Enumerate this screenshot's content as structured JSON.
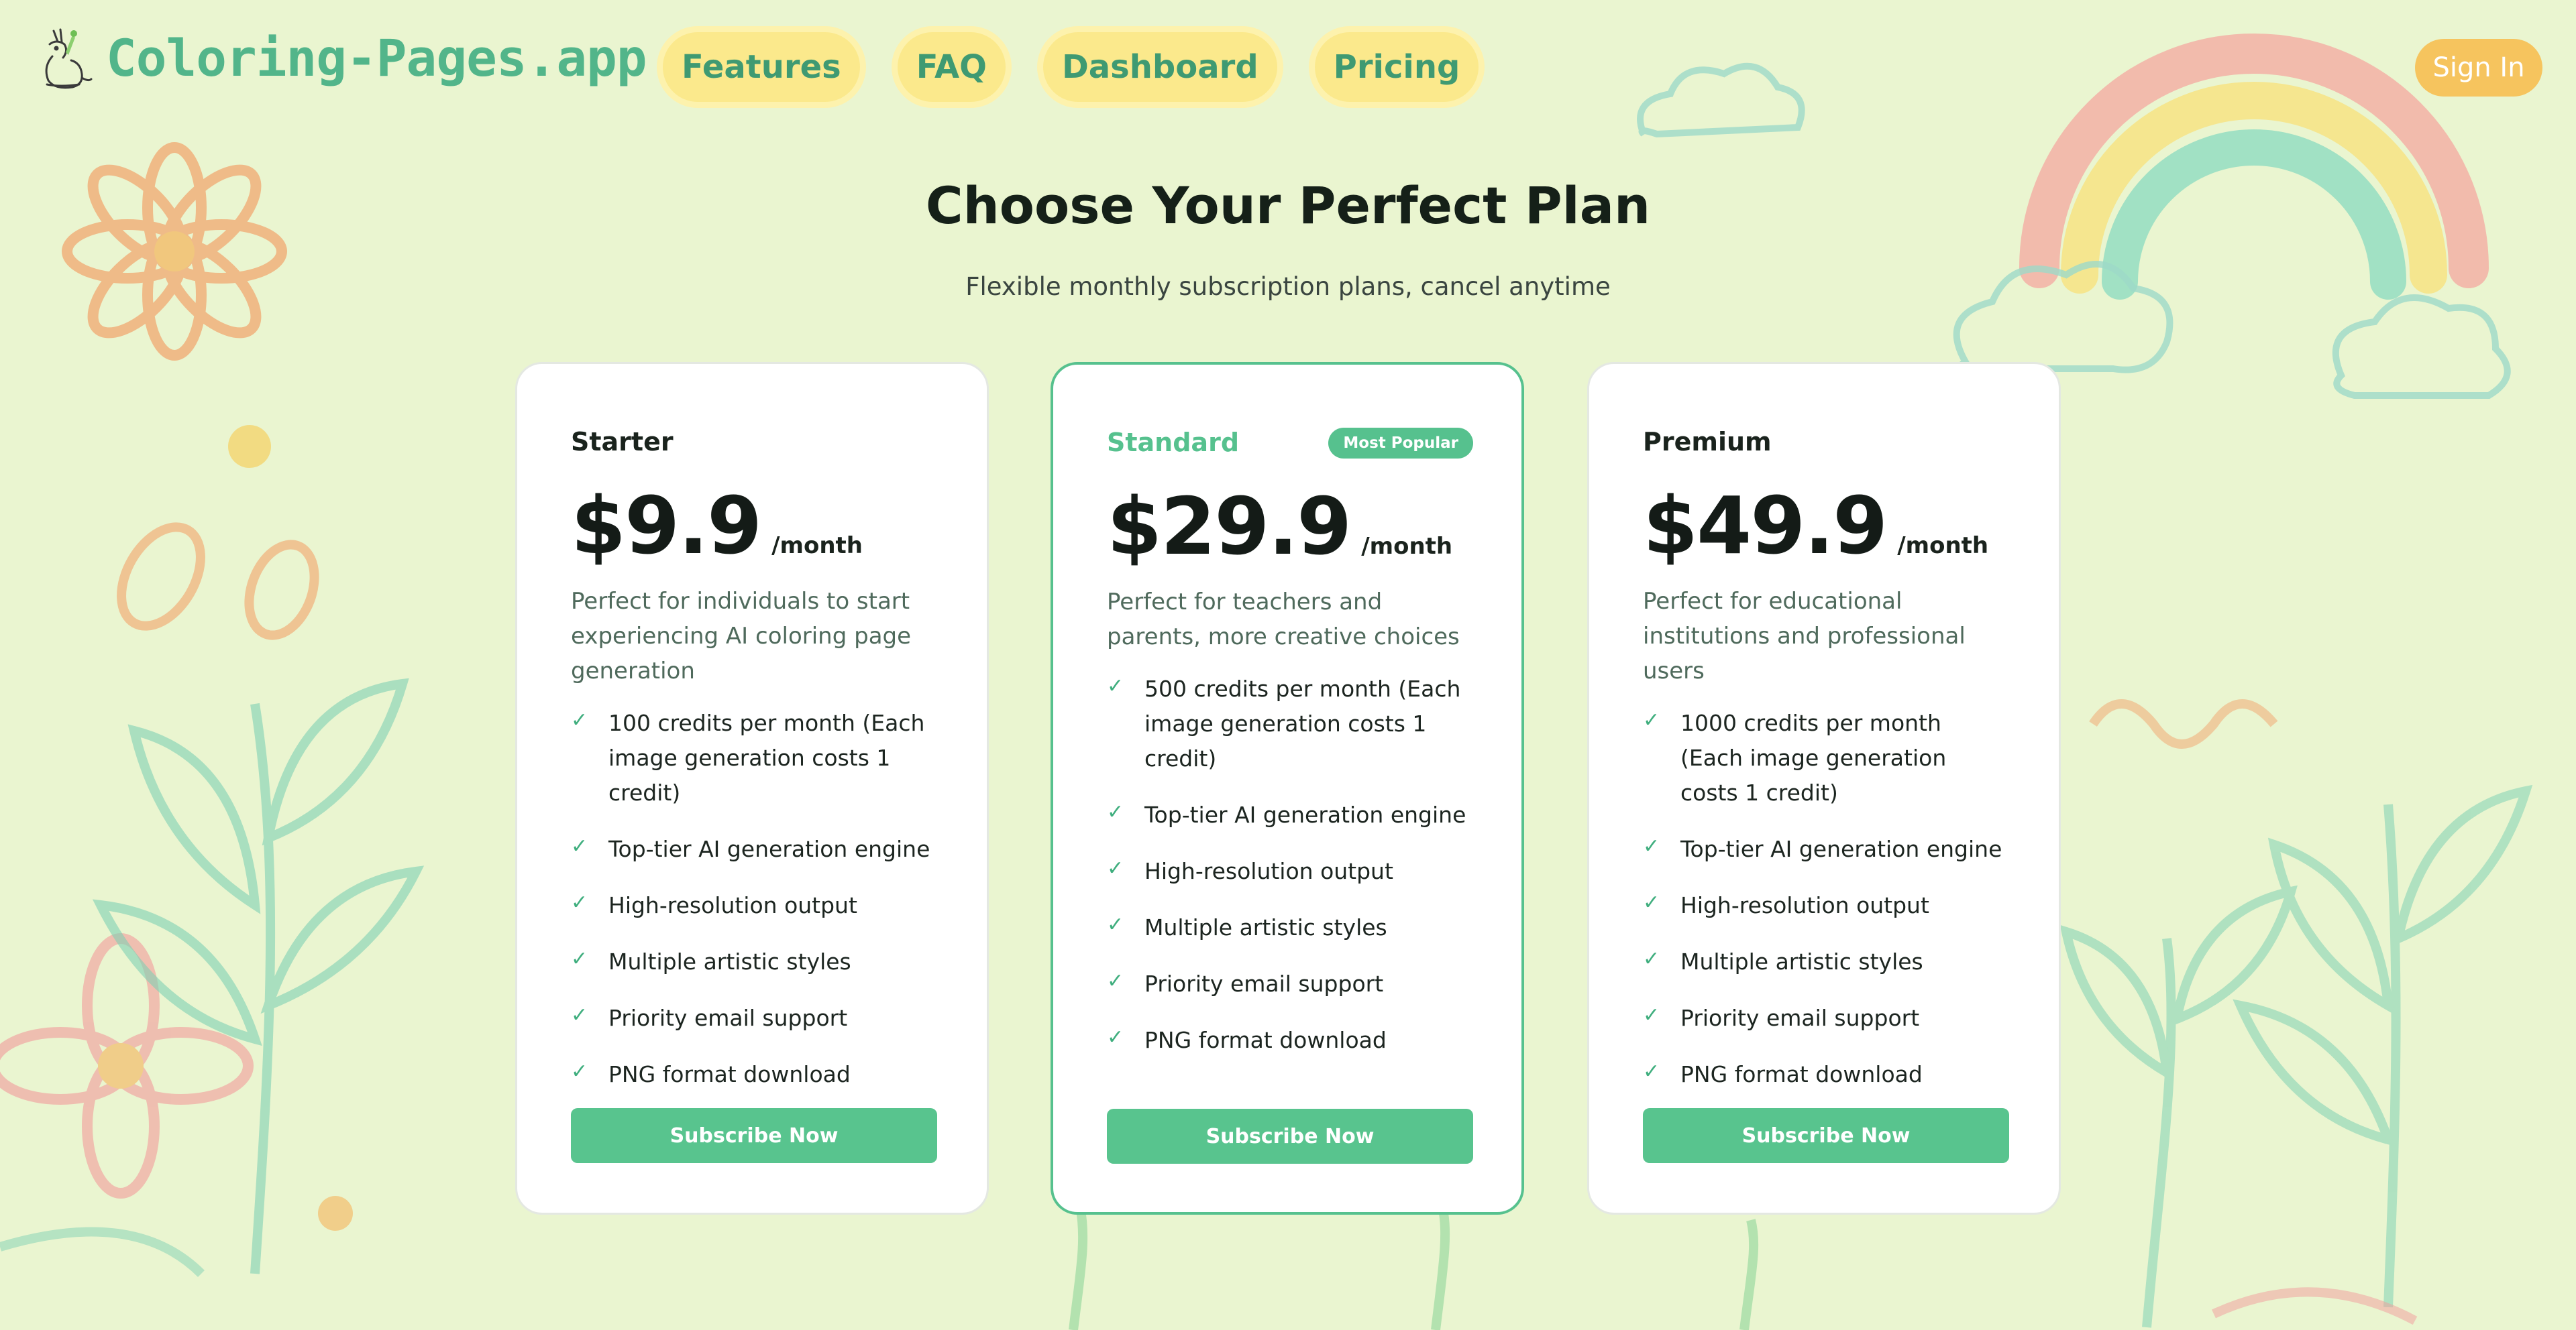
{
  "brand": {
    "name": "Coloring-Pages.app",
    "logo_icon": "kangaroo-logo-icon"
  },
  "nav": {
    "items": [
      {
        "label": "Features"
      },
      {
        "label": "FAQ"
      },
      {
        "label": "Dashboard"
      },
      {
        "label": "Pricing"
      }
    ],
    "signin_label": "Sign In"
  },
  "pricing": {
    "title": "Choose Your Perfect Plan",
    "subtitle": "Flexible monthly subscription plans, cancel anytime",
    "plans": [
      {
        "name": "Starter",
        "price": "$9.9",
        "period": "/month",
        "description": "Perfect for individuals to start experiencing AI coloring page generation",
        "features": [
          "100 credits per month (Each image generation costs 1 credit)",
          "Top-tier AI generation engine",
          "High-resolution output",
          "Multiple artistic styles",
          "Priority email support",
          "PNG format download"
        ],
        "cta": "Subscribe Now"
      },
      {
        "name": "Standard",
        "badge": "Most Popular",
        "price": "$29.9",
        "period": "/month",
        "description": "Perfect for teachers and parents, more creative choices",
        "features": [
          "500 credits per month (Each image generation costs 1 credit)",
          "Top-tier AI generation engine",
          "High-resolution output",
          "Multiple artistic styles",
          "Priority email support",
          "PNG format download"
        ],
        "cta": "Subscribe Now"
      },
      {
        "name": "Premium",
        "price": "$49.9",
        "period": "/month",
        "description": "Perfect for educational institutions and professional users",
        "features": [
          "1000 credits per month (Each image generation costs 1 credit)",
          "Top-tier AI generation engine",
          "High-resolution output",
          "Multiple artistic styles",
          "Priority email support",
          "PNG format download"
        ],
        "cta": "Subscribe Now"
      }
    ]
  },
  "colors": {
    "background": "#eaf5d0",
    "brand_green": "#52b58a",
    "nav_pill": "#fbe98c",
    "signin": "#f6c45e",
    "button_green": "#58c48e"
  }
}
